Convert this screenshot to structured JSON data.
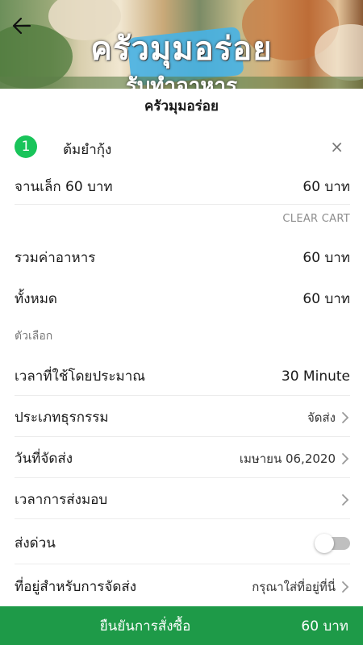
{
  "banner": {
    "title": "ครัวมุมอร่อย",
    "subtitle": "รับทำอาหาร"
  },
  "shop": {
    "name": "ครัวมุมอร่อย"
  },
  "cart": {
    "item": {
      "qty": "1",
      "name": "ต้มยำกุ้ง",
      "variant": "จานเล็ก 60 บาท",
      "price": "60 บาท"
    },
    "clear_label": "CLEAR CART",
    "subtotal_label": "รวมค่าอาหาร",
    "subtotal_value": "60 บาท",
    "total_label": "ทั้งหมด",
    "total_value": "60 บาท"
  },
  "options": {
    "section_label": "ตัวเลือก",
    "est_time_label": "เวลาที่ใช้โดยประมาณ",
    "est_time_value": "30 Minute",
    "business_type_label": "ประเภทธุรกรรม",
    "business_type_value": "จัดส่ง",
    "delivery_date_label": "วันที่จัดส่ง",
    "delivery_date_value": "เมษายน 06,2020",
    "delivery_time_label": "เวลาการส่งมอบ",
    "express_label": "ส่งด่วน",
    "express_on": false,
    "address_label": "ที่อยู่สำหรับการจัดส่ง",
    "address_placeholder": "กรุณาใส่ที่อยู่ที่นี่"
  },
  "confirm": {
    "label": "ยืนยันการสั่งซื้อ",
    "total": "60 บาท"
  },
  "colors": {
    "accent_green": "#1e9a48",
    "badge_green": "#19c45a"
  },
  "icons": [
    "back-arrow-icon",
    "close-icon",
    "chevron-right-icon"
  ]
}
